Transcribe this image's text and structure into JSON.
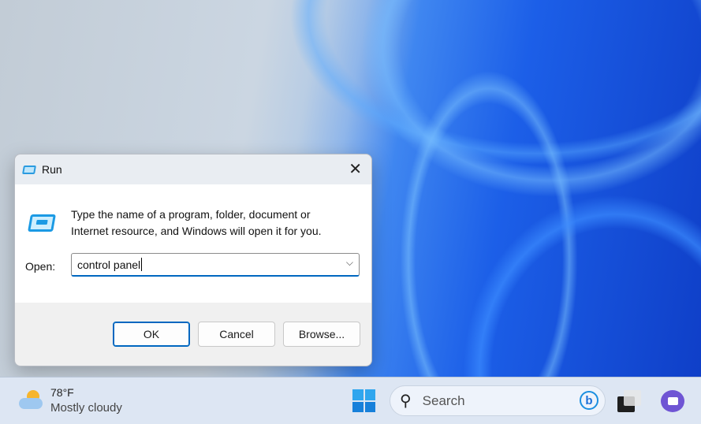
{
  "dialog": {
    "title": "Run",
    "description_line1": "Type the name of a program, folder, document or",
    "description_line2": "Internet resource, and Windows will open it for you.",
    "open_label": "Open:",
    "open_value": "control panel",
    "ok": "OK",
    "cancel": "Cancel",
    "browse": "Browse..."
  },
  "taskbar": {
    "weather_temp": "78°F",
    "weather_desc": "Mostly cloudy",
    "search_placeholder": "Search"
  },
  "colors": {
    "accent": "#0067c0",
    "wallpaper_blue": "#1c5fe8"
  }
}
